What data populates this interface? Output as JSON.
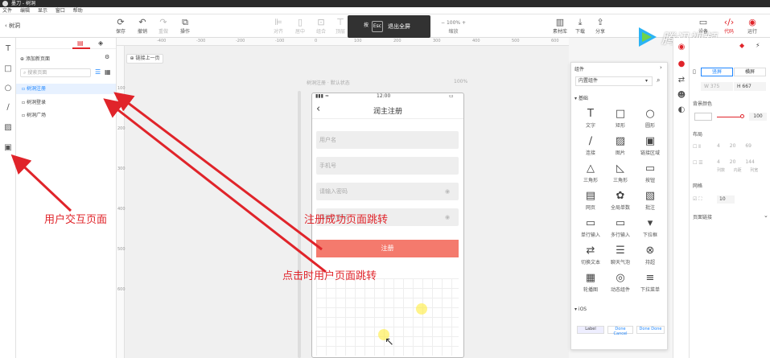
{
  "titlebar": {
    "title": "墨刀 - 树洞"
  },
  "menubar": {
    "items": [
      "文件",
      "编辑",
      "显示",
      "窗口",
      "帮助"
    ]
  },
  "toolbar": {
    "back_label": "树洞",
    "buttons": [
      "保存",
      "撤销",
      "重做",
      "操作",
      "对齐",
      "居中",
      "组合",
      "顶层",
      "底层"
    ],
    "zoom": "100%",
    "zoom_label": "缩放",
    "right_buttons": [
      "素材库",
      "下载",
      "分享",
      "设备",
      "代码",
      "运行"
    ]
  },
  "fullscreen": {
    "key1": "按",
    "key2": "Esc",
    "label": "退出全屏"
  },
  "watermark": {
    "text": "腾讯视频"
  },
  "pages": {
    "add_label": "添加新页面",
    "search_placeholder": "搜索页面",
    "items": [
      "树洞注册",
      "树洞登录",
      "树洞广场"
    ]
  },
  "canvas": {
    "link_label": "链接上一页",
    "ruler_top": [
      "-400",
      "-300",
      "-200",
      "-100",
      "0",
      "100",
      "200",
      "300",
      "400",
      "500",
      "600",
      "700",
      "800",
      "900"
    ],
    "ruler_left": [
      "100",
      "200",
      "300",
      "400",
      "500",
      "600"
    ],
    "screen_caption": "树洞注册 · 默认状态",
    "screen_zoom": "100%"
  },
  "phone": {
    "time": "12:00",
    "title": "润主注册",
    "fields": [
      "用户名",
      "手机号",
      "请输入密码",
      "请确认密码"
    ],
    "button": "注册"
  },
  "annotations": {
    "user_page": "用户交互页面",
    "register_success": "注册成功页面跳转",
    "click_jump": "点击时用户页面跳转"
  },
  "components": {
    "header": "组件",
    "select_value": "内置组件",
    "section_basic": "基础",
    "items": [
      "文字",
      "矩形",
      "圆形",
      "连接",
      "图片",
      "链接区域",
      "三角形",
      "三角形",
      "按钮",
      "网页",
      "全局单数",
      "批注",
      "单行输入",
      "多行输入",
      "下拉框",
      "切换文本",
      "聊天气泡",
      "持超",
      "轮播图",
      "动态组件",
      "下拉菜单"
    ],
    "section_ios": "iOS",
    "ios_labels": [
      "Label",
      "Done",
      "Cancel",
      "Done",
      "Done"
    ]
  },
  "properties": {
    "orientation": [
      "竖屏",
      "横屏"
    ],
    "width": "375",
    "height": "667",
    "bg_label": "背景颜色",
    "opacity": "100",
    "layout_label": "布局",
    "layout_row1": [
      "4",
      "20",
      "69"
    ],
    "layout_row2": [
      "4",
      "20",
      "144"
    ],
    "layout_captions": [
      "列数",
      "内距",
      "列宽"
    ],
    "grid_label": "网格",
    "grid_value": "10",
    "page_label": "页面链接"
  },
  "colors": {
    "accent": "#1e86ff",
    "button": "#f47a6d",
    "annotation": "#e0242a"
  }
}
